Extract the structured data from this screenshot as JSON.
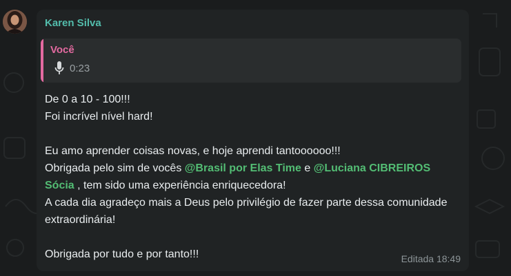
{
  "message": {
    "sender_name": "Karen Silva",
    "reply": {
      "author": "Você",
      "icon": "microphone-icon",
      "duration": "0:23"
    },
    "lines": {
      "l1": "De 0 a 10 - 100!!!",
      "l2": "Foi incrível nível hard!",
      "l3": "Eu amo aprender coisas novas, e hoje aprendi tantoooooo!!!",
      "l4_pre": "Obrigada pelo sim de vocês ",
      "mention1": "@Brasil por Elas Time",
      "l4_mid": " e ",
      "mention2": "@Luciana CIBREIROS Sócia",
      "l4_post": " , tem sido uma experiência enriquecedora!",
      "l5": "A cada dia agradeço mais a Deus pelo privilégio de fazer parte dessa comunidade extraordinária!",
      "l6": "Obrigada por tudo e por tanto!!!"
    },
    "status": "Editada 18:49"
  },
  "colors": {
    "sender": "#53bdac",
    "reply_accent": "#e36aa0",
    "mention": "#53bd74",
    "bubble": "#202324"
  }
}
